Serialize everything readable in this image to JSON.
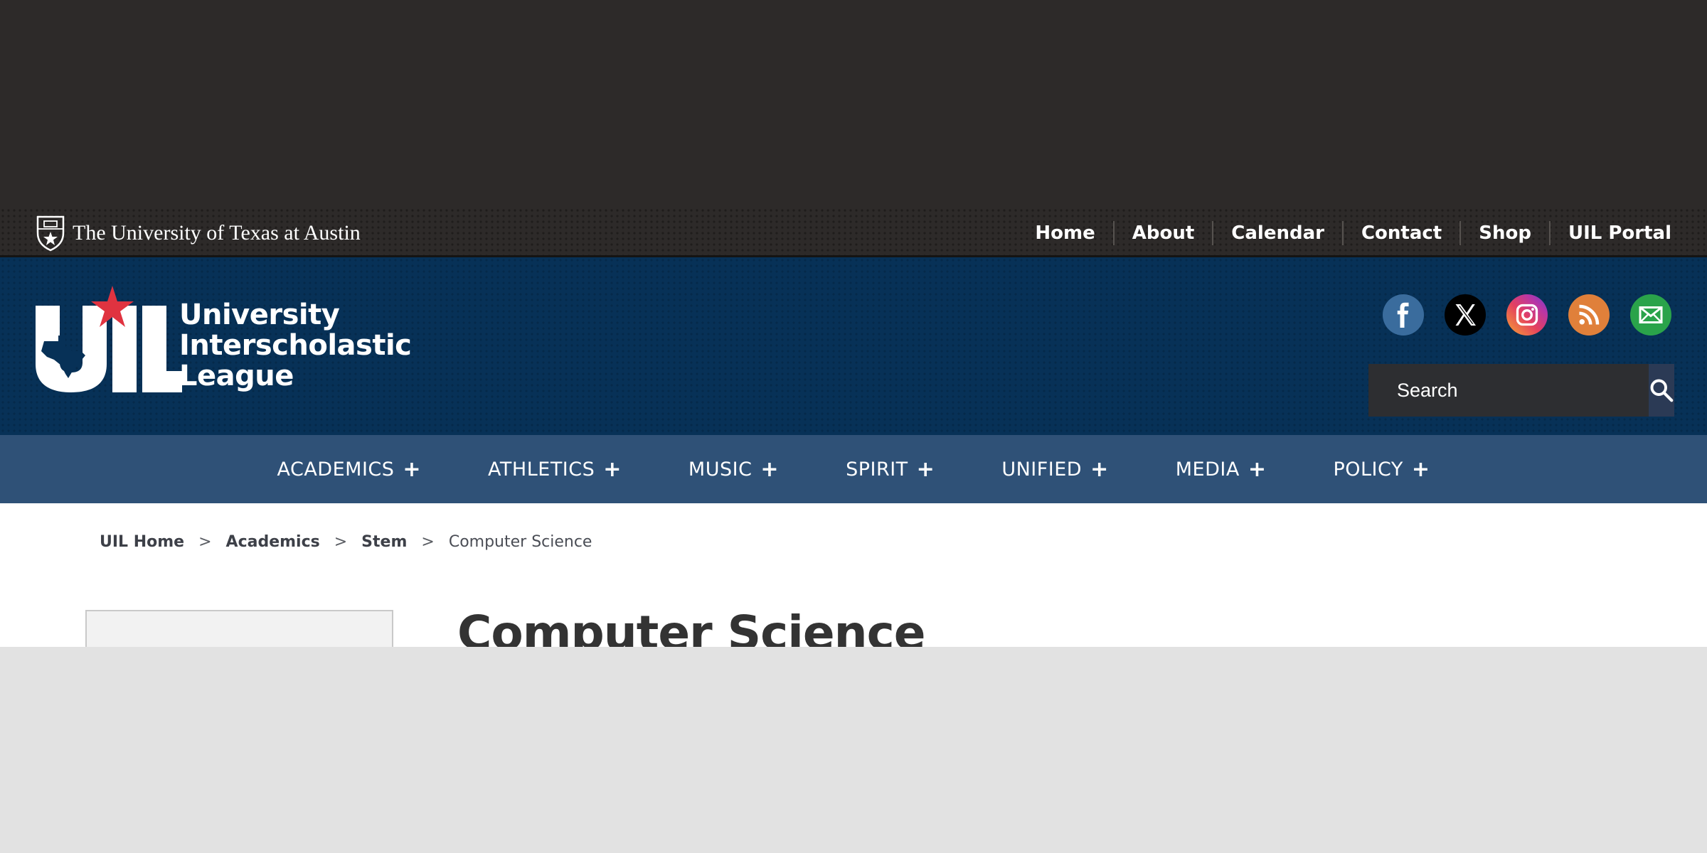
{
  "ut_bar": {
    "brand_text": "The University of Texas at Austin",
    "links": [
      {
        "label": "Home"
      },
      {
        "label": "About"
      },
      {
        "label": "Calendar"
      },
      {
        "label": "Contact"
      },
      {
        "label": "Shop"
      },
      {
        "label": "UIL Portal"
      }
    ]
  },
  "header": {
    "logo_text": "UIL",
    "logo_words": [
      "University",
      "Interscholastic",
      "League"
    ],
    "social_icons": [
      "facebook-icon",
      "x-icon",
      "instagram-icon",
      "rss-icon",
      "email-icon"
    ],
    "search": {
      "placeholder": "Search"
    }
  },
  "main_nav": {
    "items": [
      {
        "label": "ACADEMICS",
        "expander": "+"
      },
      {
        "label": "ATHLETICS",
        "expander": "+"
      },
      {
        "label": "MUSIC",
        "expander": "+"
      },
      {
        "label": "SPIRIT",
        "expander": "+"
      },
      {
        "label": "UNIFIED",
        "expander": "+"
      },
      {
        "label": "MEDIA",
        "expander": "+"
      },
      {
        "label": "POLICY",
        "expander": "+"
      }
    ]
  },
  "breadcrumb": {
    "items": [
      "UIL Home",
      "Academics",
      "Stem"
    ],
    "separator": ">",
    "current": "Computer Science"
  },
  "page": {
    "title": "Computer Science"
  },
  "colors": {
    "top_dark": "#2d2a29",
    "header_blue": "#073157",
    "nav_blue": "#2f5177",
    "logo_star_red": "#e03340"
  }
}
